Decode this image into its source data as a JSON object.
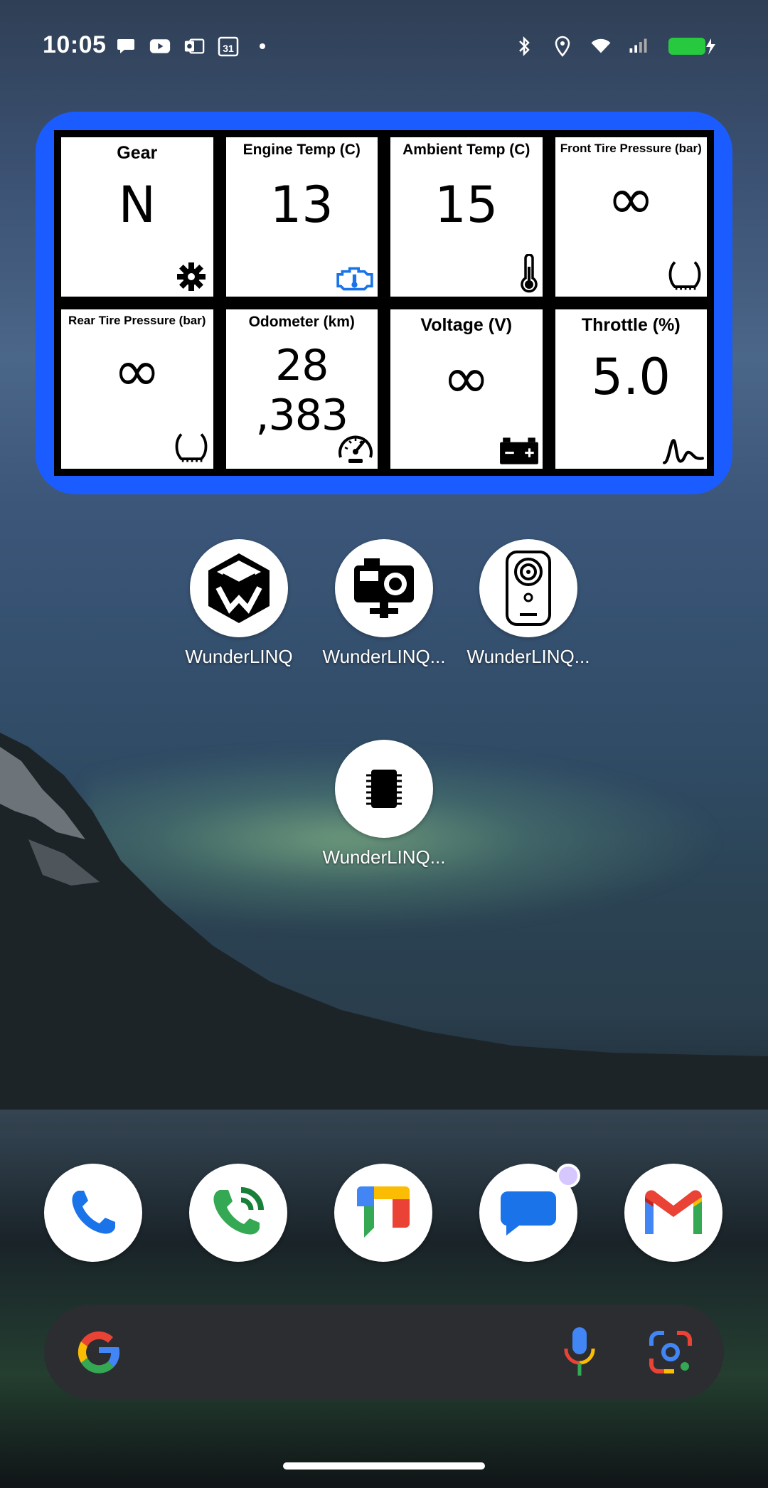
{
  "status_bar": {
    "time": "10:05",
    "left_icons": [
      "chat-bubble-icon",
      "youtube-icon",
      "outlook-icon",
      "calendar-icon",
      "dot-icon"
    ],
    "calendar_day": "31",
    "right_icons": [
      "bluetooth-icon",
      "location-icon",
      "wifi-icon",
      "signal-icon",
      "battery-charging-icon"
    ],
    "battery_color": "#27c93f"
  },
  "widget": {
    "border_color": "#1a5cff",
    "cells": [
      {
        "label": "Gear",
        "value": "N",
        "icon": "gear-icon"
      },
      {
        "label": "Engine Temp (C)",
        "value": "13",
        "icon": "engine-icon"
      },
      {
        "label": "Ambient Temp (C)",
        "value": "15",
        "icon": "thermometer-icon"
      },
      {
        "label": "Front Tire Pressure (bar)",
        "value": "∞",
        "icon": "tire-icon"
      },
      {
        "label": "Rear Tire Pressure (bar)",
        "value": "∞",
        "icon": "tire-icon"
      },
      {
        "label": "Odometer (km)",
        "value": "28 ,383",
        "icon": "speedometer-icon"
      },
      {
        "label": "Voltage (V)",
        "value": "∞",
        "icon": "battery-icon"
      },
      {
        "label": "Throttle (%)",
        "value": "5.0",
        "icon": "throttle-icon"
      }
    ]
  },
  "apps": [
    {
      "label": "WunderLINQ",
      "icon": "wunderlinq-logo-icon"
    },
    {
      "label": "WunderLINQ...",
      "icon": "action-camera-icon"
    },
    {
      "label": "WunderLINQ...",
      "icon": "remote-device-icon"
    },
    {
      "label": "WunderLINQ...",
      "icon": "chip-icon"
    }
  ],
  "dock": [
    {
      "name": "phone",
      "icon": "phone-icon"
    },
    {
      "name": "dialer",
      "icon": "phone-dialer-icon"
    },
    {
      "name": "google-chat",
      "icon": "google-chat-icon"
    },
    {
      "name": "messages",
      "icon": "messages-icon"
    },
    {
      "name": "gmail",
      "icon": "gmail-icon"
    }
  ],
  "search": {
    "icons": [
      "google-g-icon",
      "microphone-icon",
      "lens-icon"
    ]
  }
}
